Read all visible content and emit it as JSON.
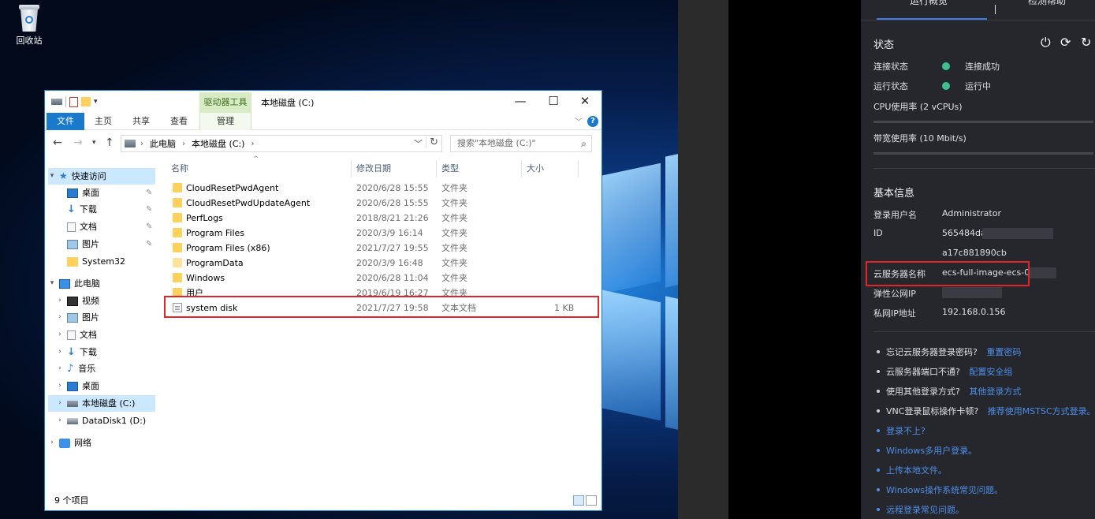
{
  "desktop": {
    "recycle_bin_label": "回收站"
  },
  "explorer": {
    "window_title": "本地磁盘 (C:)",
    "context_tab": "驱动器工具",
    "ribbon_tabs": [
      "文件",
      "主页",
      "共享",
      "查看",
      "管理"
    ],
    "address": [
      "此电脑",
      "本地磁盘 (C:)"
    ],
    "search_placeholder": "搜索\"本地磁盘 (C:)\"",
    "columns": {
      "name": "名称",
      "date": "修改日期",
      "type": "类型",
      "size": "大小"
    },
    "nav": {
      "quick_access": "快速访问",
      "quick_items": [
        "桌面",
        "下载",
        "文档",
        "图片",
        "System32"
      ],
      "this_pc": "此电脑",
      "pc_items": [
        "视频",
        "图片",
        "文档",
        "下载",
        "音乐",
        "桌面",
        "本地磁盘 (C:)",
        "DataDisk1 (D:)"
      ],
      "network": "网络"
    },
    "files": [
      {
        "name": "CloudResetPwdAgent",
        "date": "2020/6/28 15:55",
        "type": "文件夹",
        "size": ""
      },
      {
        "name": "CloudResetPwdUpdateAgent",
        "date": "2020/6/28 15:55",
        "type": "文件夹",
        "size": ""
      },
      {
        "name": "PerfLogs",
        "date": "2018/8/21 21:26",
        "type": "文件夹",
        "size": ""
      },
      {
        "name": "Program Files",
        "date": "2020/3/9 16:14",
        "type": "文件夹",
        "size": ""
      },
      {
        "name": "Program Files (x86)",
        "date": "2021/7/27 19:55",
        "type": "文件夹",
        "size": ""
      },
      {
        "name": "ProgramData",
        "date": "2020/3/9 16:48",
        "type": "文件夹",
        "size": ""
      },
      {
        "name": "Windows",
        "date": "2020/6/28 11:04",
        "type": "文件夹",
        "size": ""
      },
      {
        "name": "用户",
        "date": "2019/6/19 16:27",
        "type": "文件夹",
        "size": ""
      },
      {
        "name": "system disk",
        "date": "2021/7/27 19:58",
        "type": "文本文档",
        "size": "1 KB"
      }
    ],
    "status_count": "9 个项目"
  },
  "panel": {
    "tabs": [
      "运行概览",
      "检测帮助"
    ],
    "status_title": "状态",
    "status": [
      {
        "label": "连接状态",
        "value": "连接成功"
      },
      {
        "label": "运行状态",
        "value": "运行中"
      }
    ],
    "cpu_label": "CPU使用率 (2 vCPUs)",
    "cpu_usage": 0,
    "bandwidth_label": "带宽使用率 (10 Mbit/s)",
    "bandwidth_usage": 0,
    "basic_title": "基本信息",
    "info": {
      "user_label": "登录用户名",
      "user_value": "Administrator",
      "id_label": "ID",
      "id_value_1": "565484da-",
      "id_value_2": "a17c881890cb",
      "name_label": "云服务器名称",
      "name_value": "ecs-full-image-ecs-00",
      "eip_label": "弹性公网IP",
      "eip_value": "",
      "pip_label": "私网IP地址",
      "pip_value": "192.168.0.156"
    },
    "tips": [
      {
        "text": "忘记云服务器登录密码?",
        "link": "重置密码"
      },
      {
        "text": "云服务器端口不通?",
        "link": "配置安全组"
      },
      {
        "text": "使用其他登录方式?",
        "link": "其他登录方式"
      },
      {
        "text": "VNC登录鼠标操作卡顿?",
        "link": "推荐使用MSTSC方式登录。"
      }
    ],
    "links": [
      "登录不上?",
      "Windows多用户登录。",
      "上传本地文件。",
      "Windows操作系统常见问题。",
      "远程登录常见问题。"
    ]
  }
}
